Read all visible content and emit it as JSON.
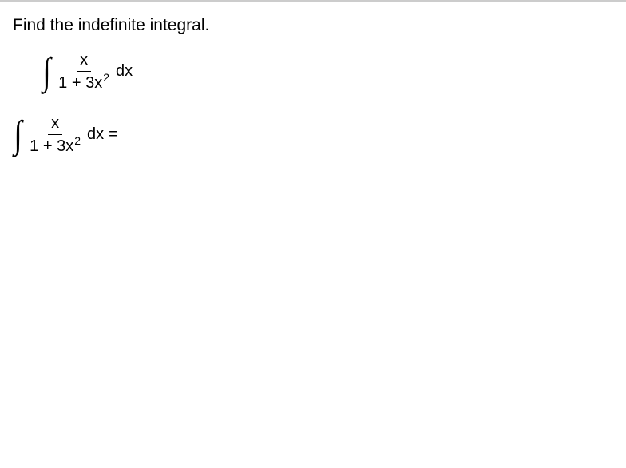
{
  "prompt": "Find the indefinite integral.",
  "integral": {
    "numerator": "x",
    "denominator_prefix": "1 + 3x",
    "denominator_exponent": "2",
    "differential": "dx"
  },
  "answer": {
    "numerator": "x",
    "denominator_prefix": "1 + 3x",
    "denominator_exponent": "2",
    "differential": "dx",
    "equals": "="
  }
}
